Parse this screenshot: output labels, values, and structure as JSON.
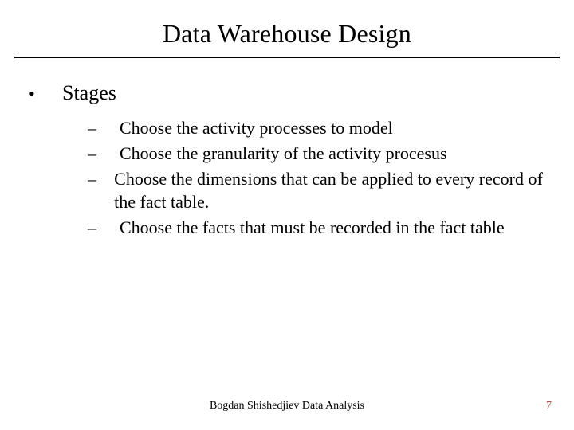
{
  "title": "Data Warehouse Design",
  "lvl1_label": "Stages",
  "bullets": [
    "Choose the activity processes to model",
    "Choose  the granularity of the activity procesus",
    "Choose the dimensions that can be applied to every record of the fact table.",
    "Choose the facts that must be recorded in the fact table"
  ],
  "footer_center": "Bogdan Shishedjiev Data Analysis",
  "page_number": "7",
  "glyphs": {
    "lvl1": "•",
    "lvl2": "–"
  }
}
